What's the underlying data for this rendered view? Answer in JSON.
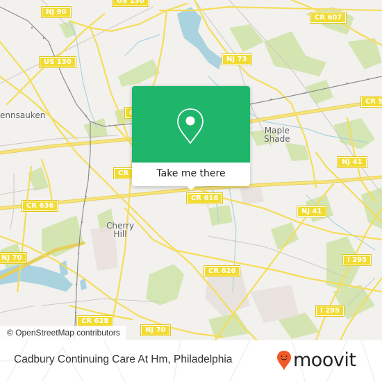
{
  "map": {
    "shields": [
      {
        "id": "us130-top",
        "label": "US 130"
      },
      {
        "id": "nj90",
        "label": "NJ 90"
      },
      {
        "id": "us130",
        "label": "US 130"
      },
      {
        "id": "nj73",
        "label": "NJ 73"
      },
      {
        "id": "cr607",
        "label": "CR 607"
      },
      {
        "id": "cr5",
        "label": "CR 5"
      },
      {
        "id": "cr-left-mid",
        "label": "CR"
      },
      {
        "id": "cr-left-low",
        "label": "CR"
      },
      {
        "id": "nj41-top",
        "label": "NJ 41"
      },
      {
        "id": "cr636",
        "label": "CR 636"
      },
      {
        "id": "cr616",
        "label": "CR 616"
      },
      {
        "id": "nj41",
        "label": "NJ 41"
      },
      {
        "id": "nj70-left",
        "label": "NJ 70"
      },
      {
        "id": "cr626",
        "label": "CR 626"
      },
      {
        "id": "i295-top",
        "label": "I 295"
      },
      {
        "id": "i295-bottom",
        "label": "I 295"
      },
      {
        "id": "cr628",
        "label": "CR 628"
      },
      {
        "id": "nj70-bottom",
        "label": "NJ 70"
      }
    ],
    "places": [
      {
        "id": "pennsauken",
        "label": "ennsauken"
      },
      {
        "id": "maple-shade",
        "label": "Maple\nShade"
      },
      {
        "id": "cherry-hill",
        "label": "Cherry\nHill"
      }
    ],
    "attribution": "© OpenStreetMap contributors"
  },
  "popup": {
    "icon": "map-pin-icon",
    "button_label": "Take me there",
    "accent": "#1fb56b"
  },
  "footer": {
    "title": "Cadbury Continuing Care At Hm, Philadelphia",
    "logo_text": "moovit",
    "logo_color": "#f05a28"
  }
}
